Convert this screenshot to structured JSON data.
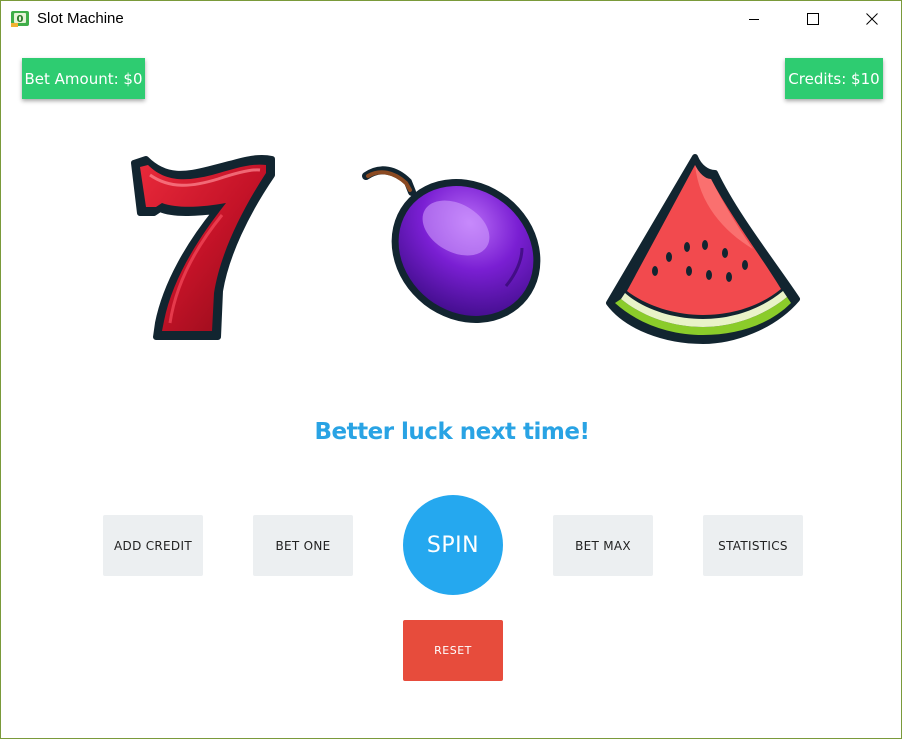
{
  "window": {
    "title": "Slot Machine"
  },
  "header": {
    "bet_amount": "Bet Amount: $0",
    "credits": "Credits: $10"
  },
  "reels": [
    {
      "symbol": "seven-icon"
    },
    {
      "symbol": "plum-icon"
    },
    {
      "symbol": "watermelon-icon"
    }
  ],
  "message": "Better luck next time!",
  "controls": {
    "add_credit": "ADD CREDIT",
    "bet_one": "BET ONE",
    "spin": "SPIN",
    "bet_max": "BET MAX",
    "statistics": "STATISTICS",
    "reset": "RESET"
  },
  "colors": {
    "badge_green": "#2ecc71",
    "spin_blue": "#25a8ef",
    "message_blue": "#29a3e4",
    "reset_red": "#e74c3c",
    "button_grey": "#eceff1"
  }
}
